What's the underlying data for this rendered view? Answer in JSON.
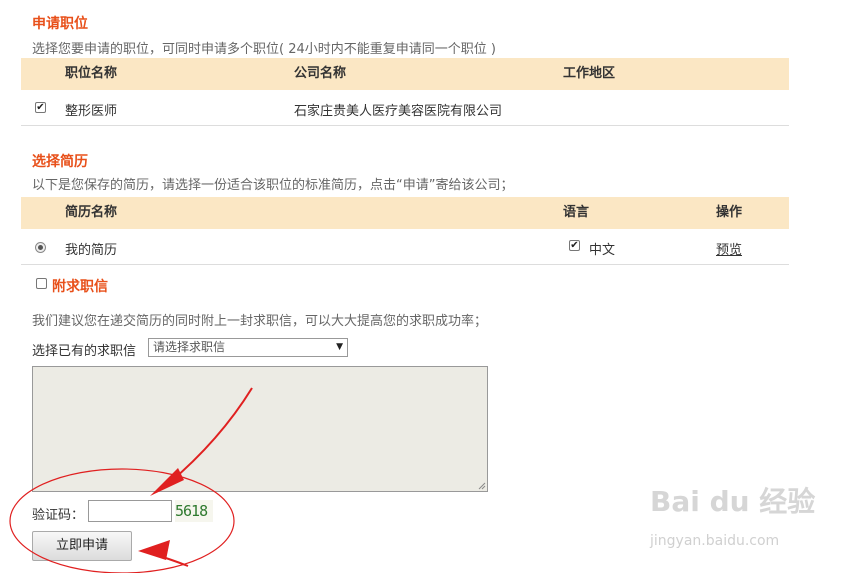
{
  "apply": {
    "title": "申请职位",
    "desc": "选择您要申请的职位，可同时申请多个职位( 24小时内不能重复申请同一个职位 )",
    "headers": [
      "职位名称",
      "公司名称",
      "工作地区"
    ],
    "rows": [
      {
        "checked": true,
        "position": "整形医师",
        "company": "石家庄贵美人医疗美容医院有限公司",
        "region": ""
      }
    ]
  },
  "resume": {
    "title": "选择简历",
    "desc": "以下是您保存的简历，请选择一份适合该职位的标准简历，点击“申请”寄给该公司；",
    "headers": [
      "简历名称",
      "语言",
      "操作"
    ],
    "rows": [
      {
        "selected": true,
        "name": "我的简历",
        "lang_checked": true,
        "language": "中文",
        "action": "预览"
      }
    ]
  },
  "cover_letter": {
    "checkbox_label": "附求职信",
    "checked": false,
    "desc": "我们建议您在递交简历的同时附上一封求职信，可以大大提高您的求职成功率；",
    "select_label": "选择已有的求职信",
    "select_value": "请选择求职信",
    "textarea_value": ""
  },
  "captcha": {
    "label": "验证码：",
    "input_value": "",
    "code": "5618"
  },
  "submit_label": "立即申请",
  "watermark": {
    "brand": "Bai du 经验",
    "url": "jingyan.baidu.com"
  },
  "colors": {
    "section_title": "#e8501a",
    "table_header_bg": "#fbe7c4",
    "annotation": "#e02020",
    "textarea_bg": "#ecebe4"
  }
}
